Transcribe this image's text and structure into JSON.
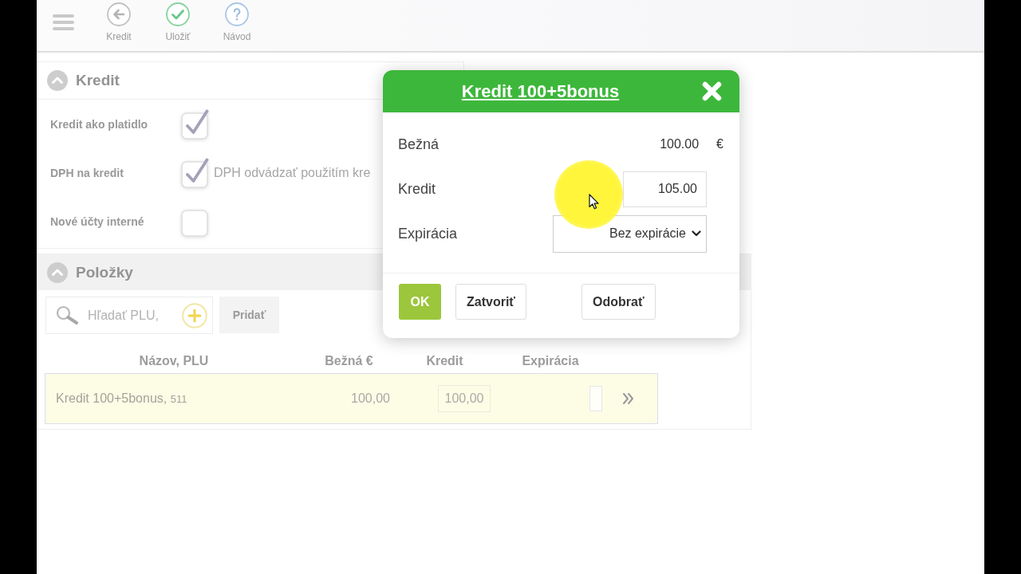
{
  "toolbar": {
    "buttons": [
      {
        "kind": "back",
        "label": "Kredit"
      },
      {
        "kind": "save",
        "label": "Uložiť"
      },
      {
        "kind": "help",
        "label": "Návod"
      }
    ]
  },
  "kredit_section": {
    "title": "Kredit",
    "expanded": true,
    "settings": [
      {
        "label": "Kredit ako platidlo",
        "checked": true
      },
      {
        "label": "DPH na kredit",
        "checked": true,
        "note": "DPH odvádzať použitím kre"
      },
      {
        "label": "Nové účty interné",
        "checked": false
      }
    ]
  },
  "items_section": {
    "title": "Položky",
    "expanded": true,
    "search": {
      "placeholder": "Hľadať PLU,"
    },
    "add_button": "Pridať",
    "table": {
      "columns": [
        "Názov, PLU",
        "Bežná €",
        "Kredit",
        "Expirácia"
      ],
      "rows": [
        {
          "name": "Kredit 100+5bonus,",
          "plu": "511",
          "price": "100,00",
          "credit": "100,00",
          "selected": true
        }
      ]
    }
  },
  "dialog": {
    "title": "Kredit 100+5bonus",
    "fields": [
      {
        "kind": "readonly",
        "label": "Bežná",
        "value": "100.00",
        "unit": "€"
      },
      {
        "kind": "input",
        "label": "Kredit",
        "value": "105.00"
      },
      {
        "kind": "select",
        "label": "Expirácia",
        "value": "Bez expirácie"
      }
    ],
    "buttons": [
      {
        "kind": "confirm",
        "label": "OK"
      },
      {
        "kind": "close",
        "label": "Zatvoriť"
      },
      {
        "kind": "remove",
        "label": "Odobrať"
      }
    ]
  }
}
